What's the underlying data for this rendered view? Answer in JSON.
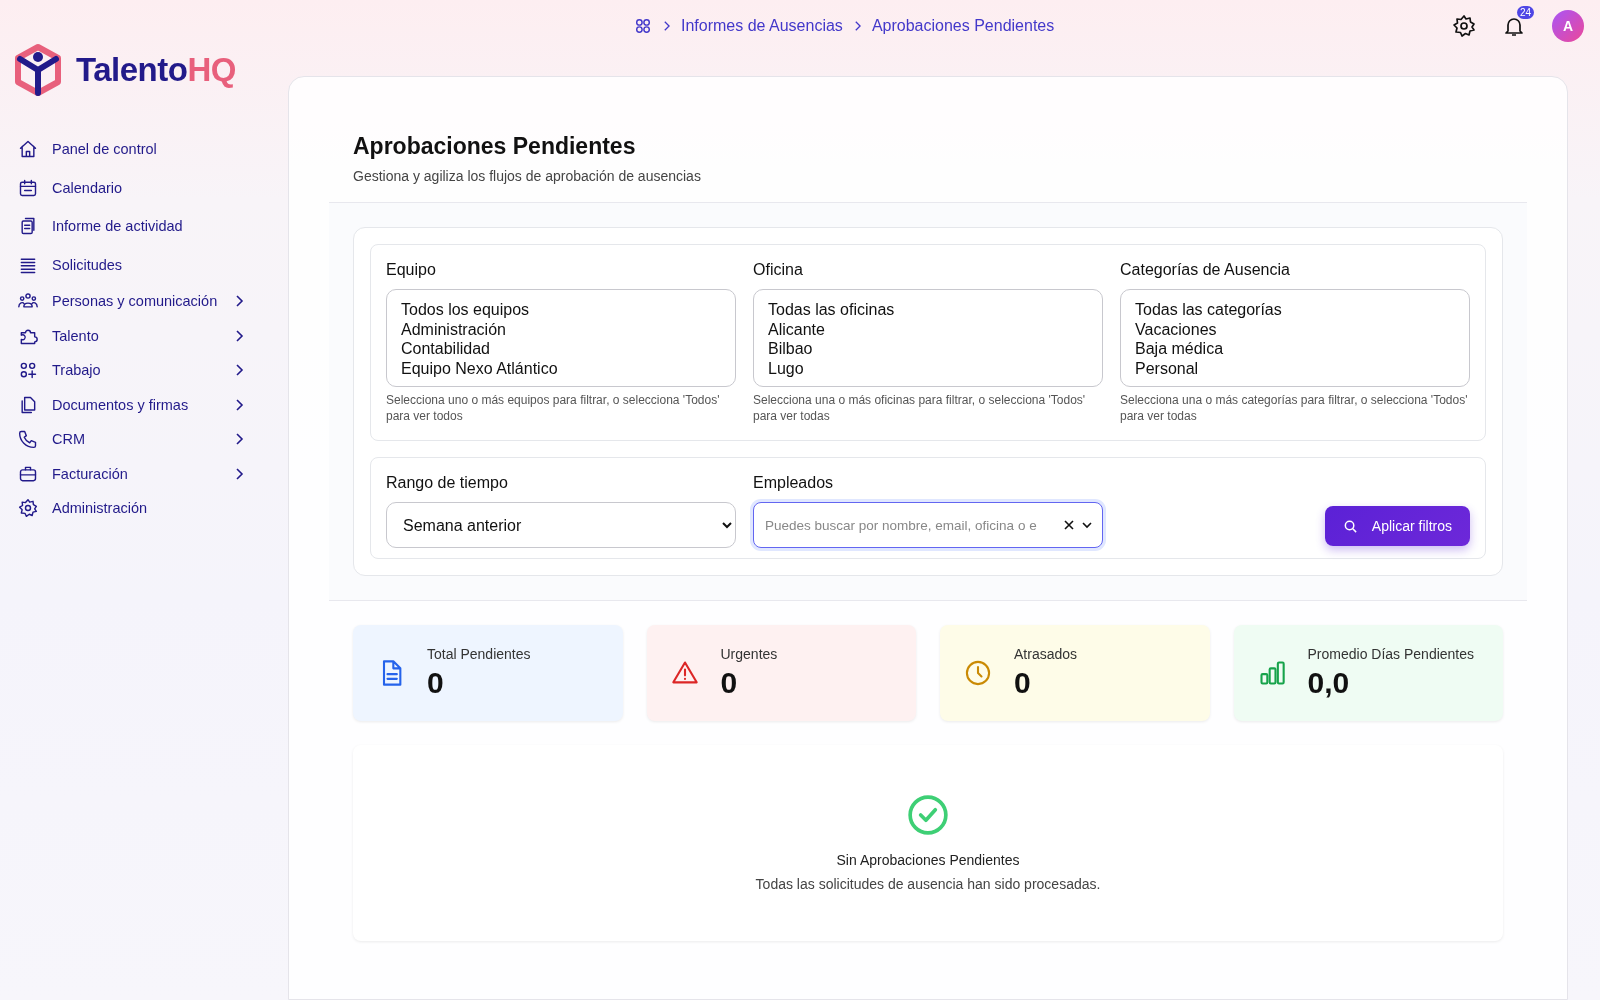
{
  "brand": {
    "name": "Talento",
    "accent": "HQ"
  },
  "sidebar": {
    "items": [
      {
        "label": "Panel de control",
        "expandable": false
      },
      {
        "label": "Calendario",
        "expandable": false
      },
      {
        "label": "Informe de actividad",
        "expandable": false
      },
      {
        "label": "Solicitudes",
        "expandable": false
      },
      {
        "label": "Personas y comunicación",
        "expandable": true
      },
      {
        "label": "Talento",
        "expandable": true
      },
      {
        "label": "Trabajo",
        "expandable": true
      },
      {
        "label": "Documentos y firmas",
        "expandable": true
      },
      {
        "label": "CRM",
        "expandable": true
      },
      {
        "label": "Facturación",
        "expandable": true
      },
      {
        "label": "Administración",
        "expandable": false
      }
    ]
  },
  "breadcrumb": [
    "Informes de Ausencias",
    "Aprobaciones Pendientes"
  ],
  "topbar": {
    "notifications": "24",
    "avatar": "A"
  },
  "page": {
    "title": "Aprobaciones Pendientes",
    "subtitle": "Gestiona y agiliza los flujos de aprobación de ausencias"
  },
  "filters": [
    {
      "label": "Equipo",
      "options": [
        "Todos los equipos",
        "Administración",
        "Contabilidad",
        "Equipo Nexo Atlántico"
      ],
      "help": "Selecciona uno o más equipos para filtrar, o selecciona 'Todos' para ver todos"
    },
    {
      "label": "Oficina",
      "options": [
        "Todas las oficinas",
        "Alicante",
        "Bilbao",
        "Lugo"
      ],
      "help": "Selecciona una o más oficinas para filtrar, o selecciona 'Todos' para ver todas"
    },
    {
      "label": "Categorías de Ausencia",
      "options": [
        "Todas las categorías",
        "Vacaciones",
        "Baja médica",
        "Personal"
      ],
      "help": "Selecciona una o más categorías para filtrar, o selecciona 'Todos' para ver todas"
    }
  ],
  "time_range": {
    "label": "Rango de tiempo",
    "value": "Semana anterior"
  },
  "employees": {
    "label": "Empleados",
    "placeholder": "Puedes buscar por nombre, email, oficina o e"
  },
  "apply_button": "Aplicar filtros",
  "stats": [
    {
      "kind": "document",
      "label": "Total Pendientes",
      "value": "0"
    },
    {
      "kind": "warning",
      "label": "Urgentes",
      "value": "0"
    },
    {
      "kind": "clock",
      "label": "Atrasados",
      "value": "0"
    },
    {
      "kind": "chart",
      "label": "Promedio Días Pendientes",
      "value": "0,0"
    }
  ],
  "empty_state": {
    "title": "Sin Aprobaciones Pendientes",
    "message": "Todas las solicitudes de ausencia han sido procesadas."
  }
}
